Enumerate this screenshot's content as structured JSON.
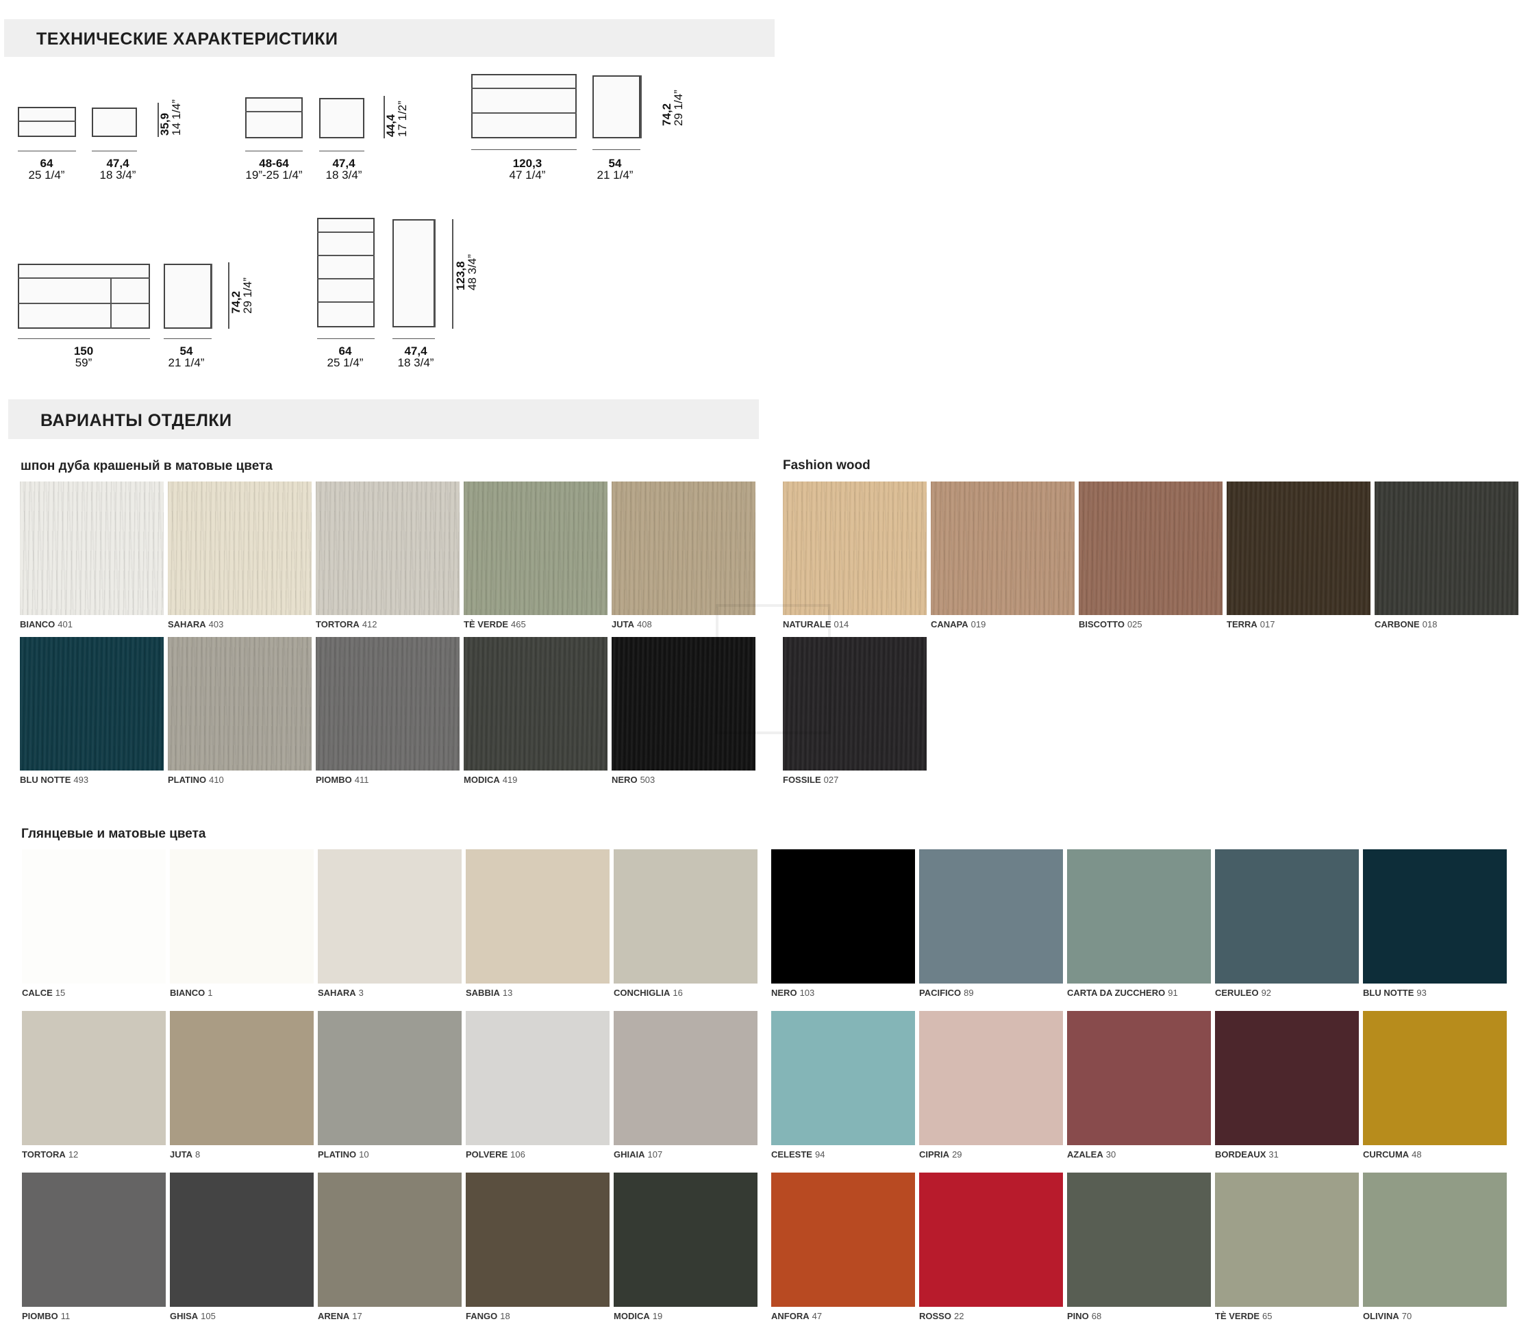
{
  "tech": {
    "title": "ТЕХНИЧЕСКИЕ ХАРАКТЕРИСТИКИ",
    "dims": [
      {
        "cm": "64",
        "in": "25 1/4”"
      },
      {
        "cm": "47,4",
        "in": "18 3/4”"
      },
      {
        "cm": "48-64",
        "in": "19”-25 1/4”"
      },
      {
        "cm": "47,4",
        "in": "18 3/4”"
      },
      {
        "cm": "120,3",
        "in": "47 1/4”"
      },
      {
        "cm": "54",
        "in": "21 1/4”"
      },
      {
        "cm": "150",
        "in": "59”"
      },
      {
        "cm": "54",
        "in": "21 1/4”"
      },
      {
        "cm": "64",
        "in": "25 1/4”"
      },
      {
        "cm": "47,4",
        "in": "18 3/4”"
      }
    ],
    "heights": [
      {
        "cm": "35,9",
        "in": "14 1/4”"
      },
      {
        "cm": "44,4",
        "in": "17 1/2”"
      },
      {
        "cm": "74,2",
        "in": "29 1/4”"
      },
      {
        "cm": "74,2",
        "in": "29 1/4”"
      },
      {
        "cm": "123,8",
        "in": "48 3/4”"
      }
    ]
  },
  "finishes": {
    "title": "ВАРИАНТЫ ОТДЕЛКИ",
    "oak_title": "шпон дуба крашеный в матовые цвета",
    "fashion_title": "Fashion wood",
    "gloss_title": "Глянцевые и матовые цвета",
    "oak": [
      {
        "name": "BIANCO",
        "code": "401",
        "color": "#ecebe6"
      },
      {
        "name": "SAHARA",
        "code": "403",
        "color": "#e6dfcc"
      },
      {
        "name": "TORTORA",
        "code": "412",
        "color": "#cfcbc1"
      },
      {
        "name": "TÈ VERDE",
        "code": "465",
        "color": "#989f87"
      },
      {
        "name": "JUTA",
        "code": "408",
        "color": "#b5a487"
      },
      {
        "name": "BLU NOTTE",
        "code": "493",
        "color": "#103a45"
      },
      {
        "name": "PLATINO",
        "code": "410",
        "color": "#a7a398"
      },
      {
        "name": "PIOMBO",
        "code": "411",
        "color": "#6d6c6b"
      },
      {
        "name": "MODICA",
        "code": "419",
        "color": "#3f413c"
      },
      {
        "name": "NERO",
        "code": "503",
        "color": "#121212"
      }
    ],
    "fashion": [
      {
        "name": "NATURALE",
        "code": "014",
        "color": "#dbbd94"
      },
      {
        "name": "CANAPA",
        "code": "019",
        "color": "#b89478"
      },
      {
        "name": "BISCOTTO",
        "code": "025",
        "color": "#946a57"
      },
      {
        "name": "TERRA",
        "code": "017",
        "color": "#3d3123"
      },
      {
        "name": "CARBONE",
        "code": "018",
        "color": "#393a35"
      },
      {
        "name": "FOSSILE",
        "code": "027",
        "color": "#262426"
      }
    ],
    "gloss_left": [
      {
        "name": "CALCE",
        "code": "15",
        "color": "#fdfdfb"
      },
      {
        "name": "BIANCO",
        "code": "1",
        "color": "#fbfaf5"
      },
      {
        "name": "SAHARA",
        "code": "3",
        "color": "#e2ddd4"
      },
      {
        "name": "SABBIA",
        "code": "13",
        "color": "#d8ccb8"
      },
      {
        "name": "CONCHIGLIA",
        "code": "16",
        "color": "#c7c3b5"
      },
      {
        "name": "TORTORA",
        "code": "12",
        "color": "#cdc8bb"
      },
      {
        "name": "JUTA",
        "code": "8",
        "color": "#aa9c84"
      },
      {
        "name": "PLATINO",
        "code": "10",
        "color": "#9c9c94"
      },
      {
        "name": "POLVERE",
        "code": "106",
        "color": "#d7d6d3"
      },
      {
        "name": "GHIAIA",
        "code": "107",
        "color": "#b6afa9"
      },
      {
        "name": "PIOMBO",
        "code": "11",
        "color": "#656464"
      },
      {
        "name": "GHISA",
        "code": "105",
        "color": "#444444"
      },
      {
        "name": "ARENA",
        "code": "17",
        "color": "#868172"
      },
      {
        "name": "FANGO",
        "code": "18",
        "color": "#5a4f3f"
      },
      {
        "name": "MODICA",
        "code": "19",
        "color": "#353a33"
      }
    ],
    "gloss_right": [
      {
        "name": "NERO",
        "code": "103",
        "color": "#000000"
      },
      {
        "name": "PACIFICO",
        "code": "89",
        "color": "#6d8089"
      },
      {
        "name": "CARTA DA ZUCCHERO",
        "code": "91",
        "color": "#7d938b"
      },
      {
        "name": "CERULEO",
        "code": "92",
        "color": "#475e66"
      },
      {
        "name": "BLU NOTTE",
        "code": "93",
        "color": "#0d2d39"
      },
      {
        "name": "CELESTE",
        "code": "94",
        "color": "#84b5b7"
      },
      {
        "name": "CIPRIA",
        "code": "29",
        "color": "#d6bbb2"
      },
      {
        "name": "AZALEA",
        "code": "30",
        "color": "#884b4c"
      },
      {
        "name": "BORDEAUX",
        "code": "31",
        "color": "#4c262c"
      },
      {
        "name": "CURCUMA",
        "code": "48",
        "color": "#b78c1c"
      },
      {
        "name": "ANFORA",
        "code": "47",
        "color": "#b84a22"
      },
      {
        "name": "ROSSO",
        "code": "22",
        "color": "#b81b2c"
      },
      {
        "name": "PINO",
        "code": "68",
        "color": "#585e53"
      },
      {
        "name": "TÈ VERDE",
        "code": "65",
        "color": "#9ea08a"
      },
      {
        "name": "OLIVINA",
        "code": "70",
        "color": "#919c86"
      }
    ]
  }
}
